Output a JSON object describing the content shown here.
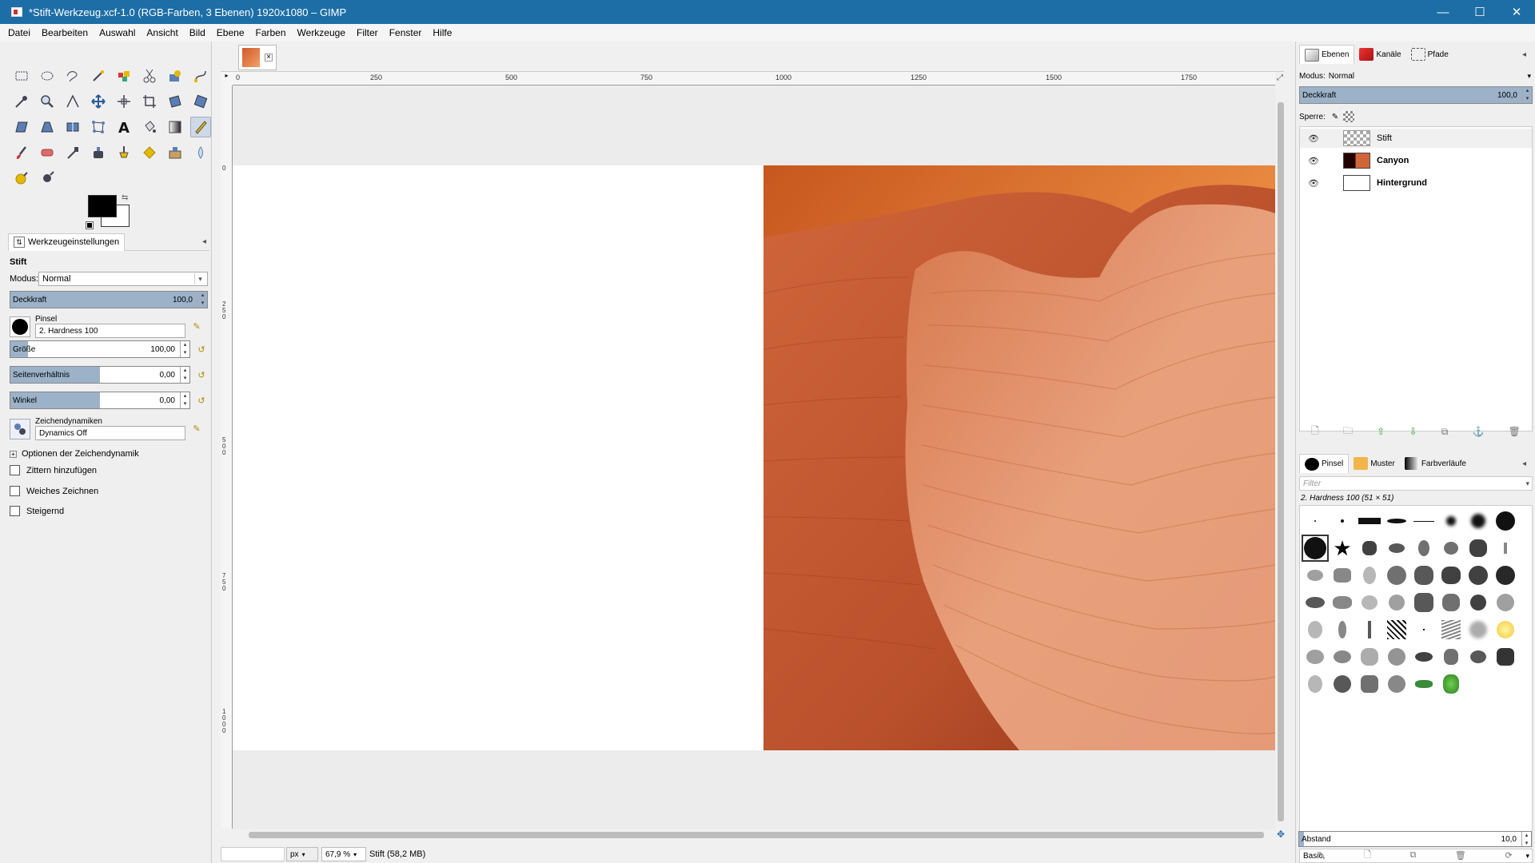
{
  "window": {
    "title": "*Stift-Werkzeug.xcf-1.0 (RGB-Farben, 3 Ebenen) 1920x1080 – GIMP",
    "minimize": "—",
    "maximize": "☐",
    "close": "✕"
  },
  "menu": [
    "Datei",
    "Bearbeiten",
    "Auswahl",
    "Ansicht",
    "Bild",
    "Ebene",
    "Farben",
    "Werkzeuge",
    "Filter",
    "Fenster",
    "Hilfe"
  ],
  "colors": {
    "titlebar": "#1d6ea6",
    "foreground": "#000000",
    "background": "#ffffff",
    "slider_fill": "#9cb2c9"
  },
  "tool_options": {
    "tab_label": "Werkzeugeinstellungen",
    "tool_name": "Stift",
    "mode_label": "Modus:",
    "mode_value": "Normal",
    "opacity_label": "Deckkraft",
    "opacity_value": "100,0",
    "brush_label": "Pinsel",
    "brush_value": "2. Hardness 100",
    "size_label": "Größe",
    "size_value": "100,00",
    "aspect_label": "Seitenverhältnis",
    "aspect_value": "0,00",
    "angle_label": "Winkel",
    "angle_value": "0,00",
    "dynamics_label": "Zeichendynamiken",
    "dynamics_value": "Dynamics Off",
    "dynamics_options": "Optionen der Zeichendynamik",
    "jitter": "Zittern hinzufügen",
    "smooth": "Weiches Zeichnen",
    "incremental": "Steigernd"
  },
  "ruler": {
    "h_labels": [
      "0",
      "250",
      "500",
      "750",
      "1000",
      "1250",
      "1500",
      "1750"
    ],
    "v_labels": [
      "0",
      "250",
      "500",
      "750",
      "1000"
    ]
  },
  "status": {
    "unit": "px",
    "zoom": "67,9 %",
    "text": "Stift (58,2 MB)"
  },
  "layers_dock": {
    "tabs": [
      "Ebenen",
      "Kanäle",
      "Pfade"
    ],
    "mode_label": "Modus:",
    "mode_value": "Normal",
    "opacity_label": "Deckkraft",
    "opacity_value": "100,0",
    "lock_label": "Sperre:",
    "layers": [
      {
        "name": "Stift",
        "visible": true
      },
      {
        "name": "Canyon",
        "visible": true
      },
      {
        "name": "Hintergrund",
        "visible": true
      }
    ]
  },
  "brushes_dock": {
    "tabs": [
      "Pinsel",
      "Muster",
      "Farbverläufe"
    ],
    "filter_placeholder": "Filter",
    "selected_brush": "2. Hardness 100 (51 × 51)",
    "preset": "Basic,",
    "spacing_label": "Abstand",
    "spacing_value": "10,0"
  }
}
